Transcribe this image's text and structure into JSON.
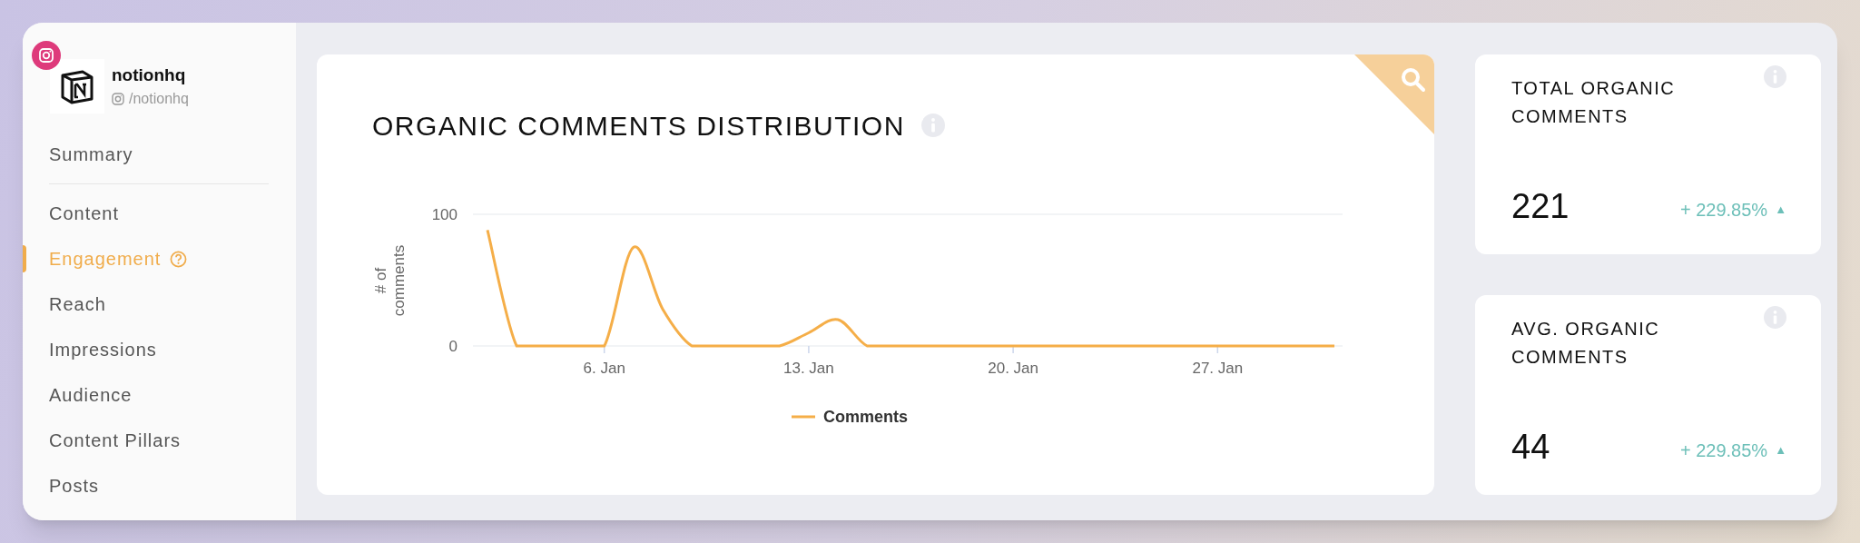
{
  "profile": {
    "name": "notionhq",
    "handle": "/notionhq"
  },
  "nav": [
    {
      "label": "Summary",
      "selected": false,
      "help": false,
      "divider_after": true
    },
    {
      "label": "Content",
      "selected": false,
      "help": false,
      "divider_after": false
    },
    {
      "label": "Engagement",
      "selected": true,
      "help": true,
      "divider_after": false
    },
    {
      "label": "Reach",
      "selected": false,
      "help": false,
      "divider_after": false
    },
    {
      "label": "Impressions",
      "selected": false,
      "help": false,
      "divider_after": false
    },
    {
      "label": "Audience",
      "selected": false,
      "help": false,
      "divider_after": false
    },
    {
      "label": "Content Pillars",
      "selected": false,
      "help": false,
      "divider_after": false
    },
    {
      "label": "Posts",
      "selected": false,
      "help": false,
      "divider_after": false
    }
  ],
  "chart_card": {
    "title": "ORGANIC COMMENTS DISTRIBUTION",
    "chart_data": {
      "type": "line",
      "ylabel": "# of comments",
      "ylim": [
        0,
        100
      ],
      "yticks": [
        0,
        100
      ],
      "categories": [
        null,
        null,
        null,
        null,
        "6. Jan",
        null,
        null,
        null,
        null,
        null,
        null,
        "13. Jan",
        null,
        null,
        null,
        null,
        null,
        null,
        "20. Jan",
        null,
        null,
        null,
        null,
        null,
        null,
        "27. Jan",
        null,
        null,
        null,
        null
      ],
      "series": [
        {
          "name": "Comments",
          "color": "#f5ae48",
          "values": [
            88,
            0,
            0,
            0,
            0,
            75,
            28,
            0,
            0,
            0,
            0,
            10,
            20,
            0,
            0,
            0,
            0,
            0,
            0,
            0,
            0,
            0,
            0,
            0,
            0,
            0,
            0,
            0,
            0,
            0
          ]
        }
      ]
    }
  },
  "stats": [
    {
      "title": "TOTAL ORGANIC COMMENTS",
      "value": "221",
      "change": "+ 229.85%",
      "arrow": "▲"
    },
    {
      "title": "AVG. ORGANIC COMMENTS",
      "value": "44",
      "change": "+ 229.85%",
      "arrow": "▲"
    }
  ]
}
